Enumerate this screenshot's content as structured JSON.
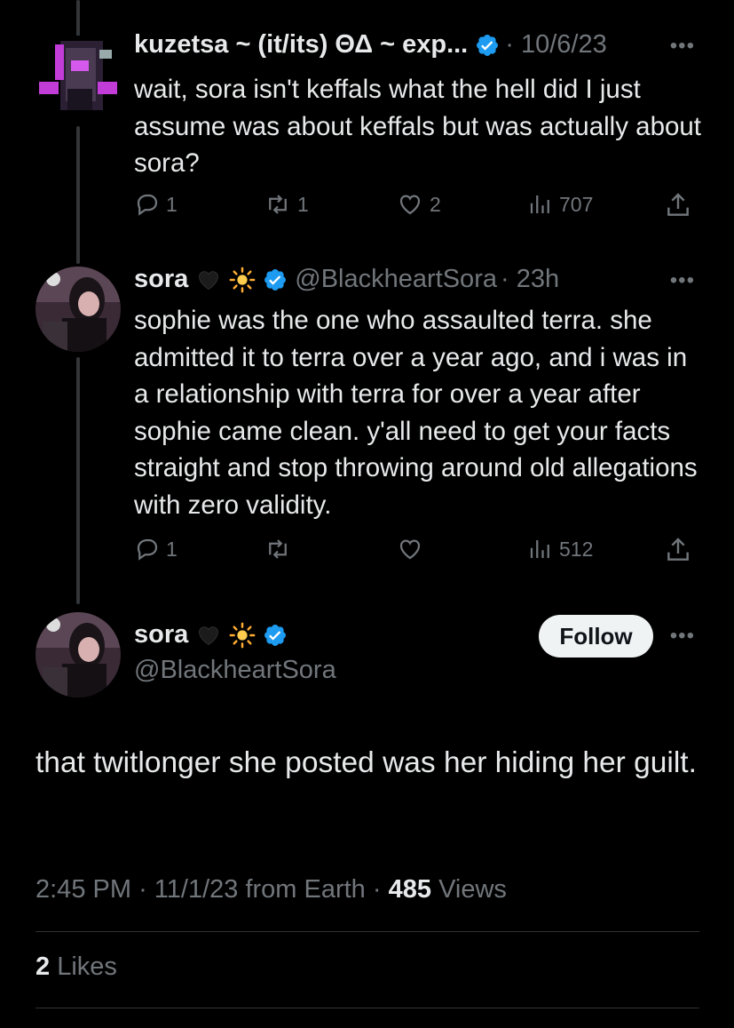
{
  "tweets": [
    {
      "name": "kuzetsa ~ (it/its) ΘΔ ~ exp...",
      "time": "· 10/6/23",
      "text": "wait, sora isn't keffals what the hell did I just assume was about keffals but was actually about sora?",
      "replies": "1",
      "retweets": "1",
      "likes": "2",
      "views": "707"
    },
    {
      "name": "sora",
      "handle": "@BlackheartSora",
      "time": "· 23h",
      "text": "sophie was the one who assaulted terra. she admitted it to terra over a year ago, and i was in a relationship with terra for over a year after sophie came clean. y'all need to get your facts straight and stop throwing around old allegations with zero validity.",
      "replies": "1",
      "views": "512"
    }
  ],
  "main": {
    "name": "sora",
    "handle": "@BlackheartSora",
    "follow_label": "Follow",
    "text": "that twitlonger she posted was her hiding her guilt.",
    "time": "2:45 PM",
    "date": "11/1/23 from Earth",
    "views_count": "485",
    "views_label": "Views",
    "likes_count": "2",
    "likes_label": "Likes"
  },
  "icons": {
    "reply": "reply-icon",
    "retweet": "retweet-icon",
    "like": "heart-icon",
    "views": "views-icon",
    "share": "share-icon",
    "verified": "verified-badge-icon",
    "more": "more-icon"
  },
  "colors": {
    "verified": "#1d9bf0",
    "muted": "#71767b",
    "text": "#e7e9ea",
    "bg": "#000000"
  }
}
